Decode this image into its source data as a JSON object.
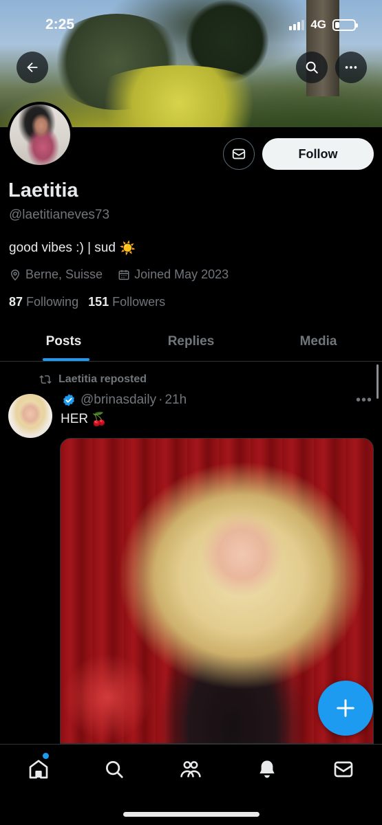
{
  "status_bar": {
    "time": "2:25",
    "network": "4G"
  },
  "profile": {
    "follow_label": "Follow",
    "name": "Laetitia",
    "handle": "@laetitianeves73",
    "bio": "good vibes :) | sud",
    "bio_emoji": "☀️",
    "location": "Berne, Suisse",
    "joined": "Joined May 2023",
    "following_count": "87",
    "following_label": "Following",
    "followers_count": "151",
    "followers_label": "Followers"
  },
  "tabs": [
    {
      "label": "Posts",
      "active": true
    },
    {
      "label": "Replies",
      "active": false
    },
    {
      "label": "Media",
      "active": false
    }
  ],
  "post": {
    "repost_label": "Laetitia reposted",
    "handle": "@brinasdaily",
    "separator": "·",
    "time": "21h",
    "more": "•••",
    "text": "HER",
    "text_emoji": "🍒"
  },
  "colors": {
    "accent": "#1d9bf0",
    "background": "#000000",
    "text_primary": "#e7e9ea",
    "text_secondary": "#71767b",
    "border": "#2f3336"
  },
  "icons": {
    "back": "arrow-left-icon",
    "search": "search-icon",
    "more": "more-horizontal-icon",
    "message": "envelope-icon",
    "location": "location-pin-icon",
    "calendar": "calendar-icon",
    "repost": "repost-icon",
    "verified": "verified-badge-icon",
    "compose": "plus-icon",
    "nav": [
      "home-icon",
      "search-icon",
      "communities-icon",
      "notifications-icon",
      "messages-icon"
    ]
  }
}
